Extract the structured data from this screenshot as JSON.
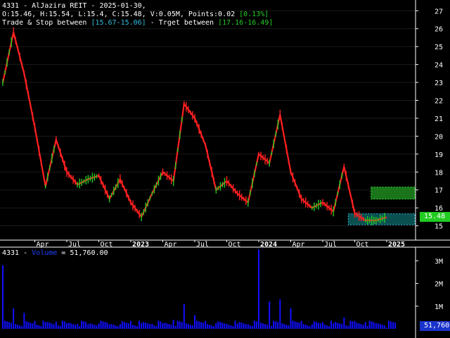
{
  "header": {
    "line1": "4331 - AlJazira REIT - 2025-01-30,",
    "line2_main": "O:15.46, H:15.54, L:15.4, C:15.48, V:0.05M, Points:0.02 ",
    "line2_pct": "[0.13%]",
    "line3_a": "Trade & Stop between ",
    "line3_stop": "[15.67-15.06]",
    "line3_b": " - Trget between ",
    "line3_target": "[17.16-16.49]"
  },
  "volume_header": {
    "prefix": "4331 - ",
    "label": "Volume",
    "value_text": " = 51,760.00"
  },
  "price_badge": "15.48",
  "volume_badge": "51,760",
  "colors": {
    "up": "#22cc22",
    "down": "#ff2020",
    "volume": "#1010ff",
    "stop_zone": "#0e6b6b",
    "target_zone": "#1f8a1f",
    "badge": "#22cc22",
    "volume_badge": "#1a33cc"
  },
  "chart_data": [
    {
      "type": "line",
      "title": "4331 - AlJazira REIT",
      "y_ticks": [
        15,
        16,
        17,
        18,
        19,
        20,
        21,
        22,
        23,
        24,
        25,
        26,
        27
      ],
      "ylim": [
        14.2,
        27.6
      ],
      "x_ticks": [
        "Apr",
        "Jul",
        "Oct",
        "2023",
        "Apr",
        "Jul",
        "Oct",
        "2024",
        "Apr",
        "Jul",
        "Oct",
        "2025"
      ],
      "x": [
        "2022-01",
        "2022-02",
        "2022-03",
        "2022-04",
        "2022-05",
        "2022-06",
        "2022-07",
        "2022-08",
        "2022-09",
        "2022-10",
        "2022-11",
        "2022-12",
        "2023-01",
        "2023-02",
        "2023-03",
        "2023-04",
        "2023-05",
        "2023-06",
        "2023-07",
        "2023-08",
        "2023-09",
        "2023-10",
        "2023-11",
        "2023-12",
        "2024-01",
        "2024-02",
        "2024-03",
        "2024-04",
        "2024-05",
        "2024-06",
        "2024-07",
        "2024-08",
        "2024-09",
        "2024-10",
        "2024-11",
        "2024-12",
        "2025-01"
      ],
      "series": [
        {
          "values": [
            23.0,
            25.8,
            23.5,
            20.5,
            17.2,
            19.8,
            18.0,
            17.3,
            17.6,
            17.8,
            16.5,
            17.6,
            16.3,
            15.5,
            16.8,
            18.0,
            17.5,
            21.8,
            21.0,
            19.5,
            17.0,
            17.5,
            16.8,
            16.3,
            19.0,
            18.5,
            21.2,
            18.0,
            16.5,
            16.0,
            16.3,
            15.8,
            18.3,
            15.7,
            15.3,
            15.3,
            15.48
          ]
        }
      ],
      "zones": {
        "trade_stop": [
          15.06,
          15.67
        ],
        "target": [
          16.49,
          17.16
        ]
      }
    },
    {
      "type": "bar",
      "title": "Volume",
      "y_ticks": [
        "1M",
        "2M",
        "3M"
      ],
      "y_tick_values": [
        1000000,
        2000000,
        3000000
      ],
      "ylim": [
        0,
        3600000
      ],
      "x": [
        "2022-01",
        "2022-02",
        "2022-03",
        "2022-04",
        "2022-05",
        "2022-06",
        "2022-07",
        "2022-08",
        "2022-09",
        "2022-10",
        "2022-11",
        "2022-12",
        "2023-01",
        "2023-02",
        "2023-03",
        "2023-04",
        "2023-05",
        "2023-06",
        "2023-07",
        "2023-08",
        "2023-09",
        "2023-10",
        "2023-11",
        "2023-12",
        "2024-01",
        "2024-02",
        "2024-03",
        "2024-04",
        "2024-05",
        "2024-06",
        "2024-07",
        "2024-08",
        "2024-09",
        "2024-10",
        "2024-11",
        "2024-12",
        "2025-01"
      ],
      "values": [
        2800000,
        900000,
        700000,
        350000,
        300000,
        320000,
        250000,
        220000,
        200000,
        230000,
        200000,
        210000,
        350000,
        260000,
        220000,
        250000,
        400000,
        1100000,
        600000,
        350000,
        250000,
        220000,
        230000,
        200000,
        3500000,
        1200000,
        1300000,
        900000,
        350000,
        200000,
        300000,
        250000,
        500000,
        350000,
        300000,
        250000,
        51760
      ]
    }
  ]
}
